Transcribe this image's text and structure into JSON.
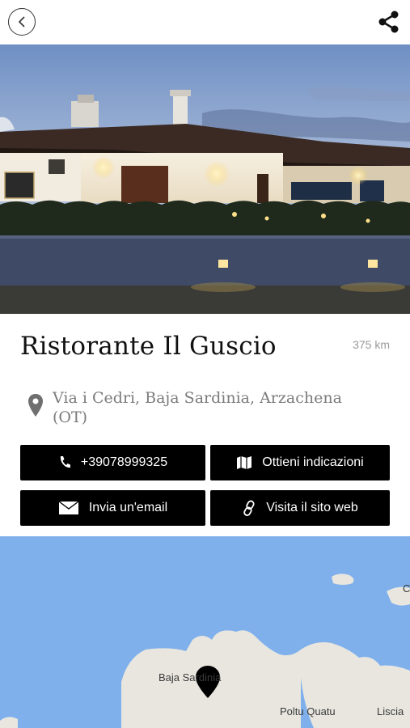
{
  "header": {
    "back_icon": "chevron-left-icon",
    "share_icon": "share-icon"
  },
  "place": {
    "name": "Ristorante Il Guscio",
    "distance": "375 km",
    "address": "Via i Cedri, Baja Sardinia, Arzachena (OT)"
  },
  "actions": {
    "phone_label": "+39078999325",
    "directions_label": "Ottieni indicazioni",
    "email_label": "Invia un'email",
    "website_label": "Visita il sito web"
  },
  "map": {
    "labels": {
      "baja": "Baja Sardinia",
      "poltu": "Poltu Quatu",
      "liscia": "Liscia",
      "edge_c": "C"
    },
    "water_color": "#7fb0ec",
    "land_color": "#e8e6df"
  }
}
